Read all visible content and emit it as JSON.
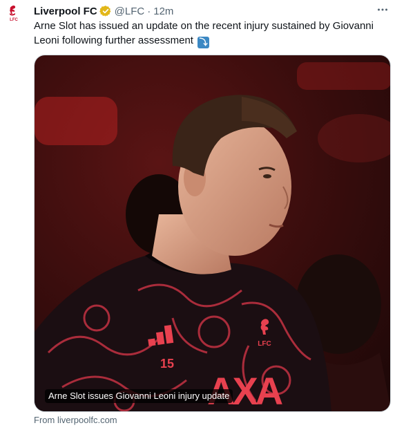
{
  "account": {
    "name": "Liverpool FC",
    "handle": "@LFC",
    "separator": "·",
    "time": "12m",
    "avatar_text": "LFC",
    "verified_color": "#e2b719"
  },
  "tweet": {
    "text": "Arne Slot has issued an update on the recent injury sustained by Giovanni Leoni following further assessment",
    "emoji": "⤵"
  },
  "card": {
    "caption": "Arne Slot issues Giovanni Leoni injury update",
    "source": "From liverpoolfc.com",
    "shirt_number": "15",
    "sponsor": "AXA",
    "crest_text": "LFC"
  },
  "colors": {
    "brand_red": "#c8102e",
    "muted_text": "#536471"
  }
}
